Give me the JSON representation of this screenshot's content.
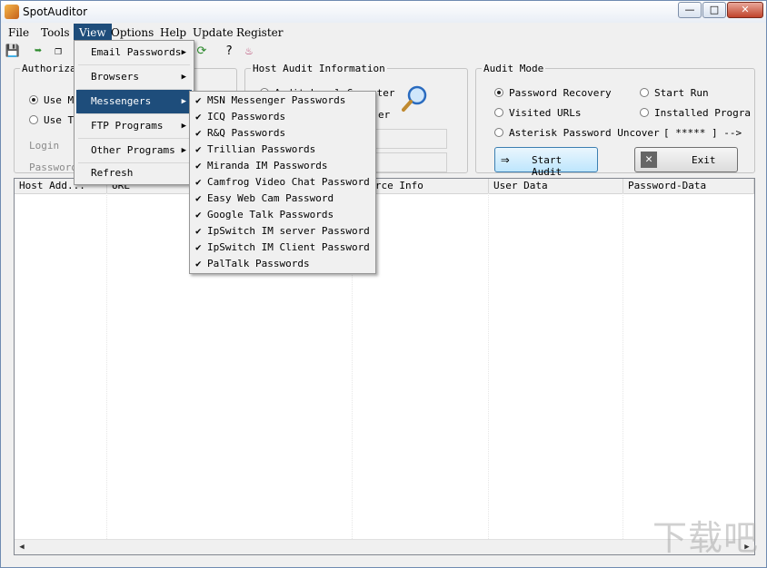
{
  "window": {
    "title": "SpotAuditor"
  },
  "menubar": {
    "items": [
      {
        "label": "File"
      },
      {
        "label": "Tools"
      },
      {
        "label": "View"
      },
      {
        "label": "Options"
      },
      {
        "label": "Help"
      },
      {
        "label": "Update"
      },
      {
        "label": "Register"
      }
    ]
  },
  "view_menu": {
    "items": [
      {
        "label": "Email Passwords",
        "has_submenu": true
      },
      {
        "label": "Browsers",
        "has_submenu": true
      },
      {
        "label": "Messengers",
        "has_submenu": true,
        "highlighted": true
      },
      {
        "label": "FTP Programs",
        "has_submenu": true
      },
      {
        "label": "Other Programs",
        "has_submenu": true
      },
      {
        "label": "Refresh",
        "has_submenu": false
      }
    ]
  },
  "messengers_submenu": {
    "items": [
      {
        "label": "MSN Messenger Passwords",
        "checked": true
      },
      {
        "label": "ICQ Passwords",
        "checked": true
      },
      {
        "label": "R&Q Passwords",
        "checked": true
      },
      {
        "label": "Trillian Passwords",
        "checked": true
      },
      {
        "label": "Miranda IM Passwords",
        "checked": true
      },
      {
        "label": "Camfrog Video Chat Password",
        "checked": true
      },
      {
        "label": "Easy Web Cam Password",
        "checked": true
      },
      {
        "label": "Google Talk Passwords",
        "checked": true
      },
      {
        "label": "IpSwitch IM server Password",
        "checked": true
      },
      {
        "label": "IpSwitch IM Client Password",
        "checked": true
      },
      {
        "label": "PalTalk Passwords",
        "checked": true
      }
    ]
  },
  "authorization": {
    "legend": "Authorizat",
    "opt1": "Use M",
    "opt2": "Use T",
    "login_label": "Login",
    "password_label": "Password"
  },
  "host_audit": {
    "legend": "Host Audit Information",
    "option": "Audit Local Computer",
    "option2_fragment": "er"
  },
  "audit_mode": {
    "legend": "Audit Mode",
    "options": [
      {
        "label": "Password Recovery",
        "selected": true
      },
      {
        "label": "Start Run",
        "selected": false
      },
      {
        "label": "Visited URLs",
        "selected": false
      },
      {
        "label": "Installed Progra",
        "selected": false
      },
      {
        "label": "Asterisk Password Uncover",
        "selected": false
      }
    ],
    "asterisk_hint": "[ ***** ] -->",
    "start_label": "Start Audit",
    "exit_label": "Exit"
  },
  "grid": {
    "columns": [
      "Host Add...",
      "URL",
      "Source Info",
      "User Data",
      "Password-Data"
    ]
  },
  "watermark": "下载吧"
}
